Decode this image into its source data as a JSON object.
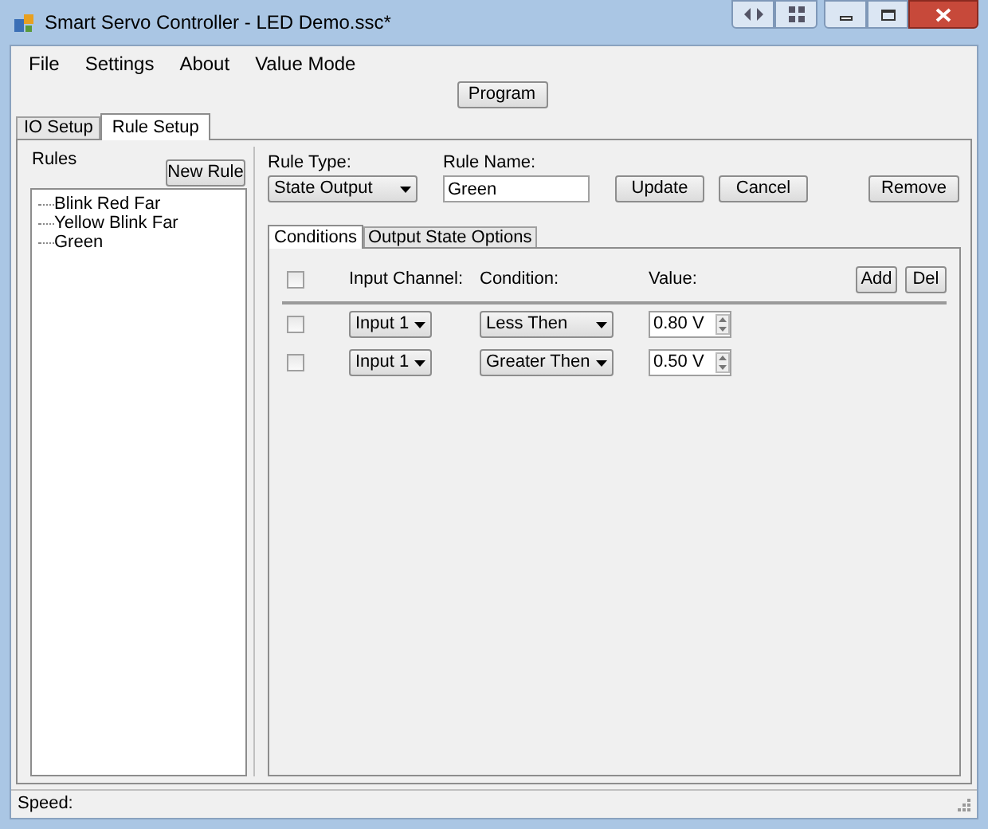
{
  "window": {
    "title": "Smart Servo Controller - LED Demo.ssc*"
  },
  "menu": [
    "File",
    "Settings",
    "About",
    "Value Mode"
  ],
  "program_button": "Program",
  "tabs": [
    {
      "label": "IO Setup",
      "selected": false
    },
    {
      "label": "Rule Setup",
      "selected": true
    }
  ],
  "rules": {
    "title": "Rules",
    "new_button": "New Rule",
    "items": [
      "Blink Red Far",
      "Yellow Blink Far",
      "Green"
    ]
  },
  "rule_type": {
    "label": "Rule Type:",
    "value": "State Output"
  },
  "rule_name": {
    "label": "Rule Name:",
    "value": "Green"
  },
  "buttons": [
    "Update",
    "Cancel"
  ],
  "remove_button": "Remove",
  "inner_tabs": [
    {
      "label": "Conditions",
      "selected": true
    },
    {
      "label": "Output State Options",
      "selected": false
    }
  ],
  "conditions": {
    "header_checked": false,
    "columns": [
      "Input Channel:",
      "Condition:",
      "Value:"
    ],
    "add_button": "Add",
    "del_button": "Del",
    "rows": [
      {
        "checked": false,
        "channel": "Input 1",
        "condition": "Less Then",
        "value": "0.80 V"
      },
      {
        "checked": false,
        "channel": "Input 1",
        "condition": "Greater Then",
        "value": "0.50 V"
      }
    ]
  },
  "status_bar": {
    "label": "Speed:"
  }
}
